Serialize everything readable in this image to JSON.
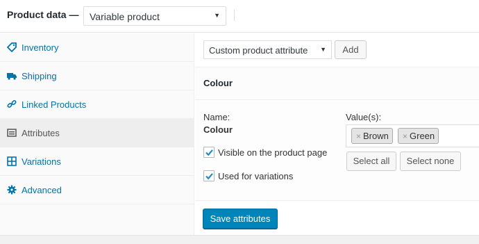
{
  "header": {
    "title": "Product data —",
    "product_type": "Variable product"
  },
  "sidebar": {
    "items": [
      {
        "label": "Inventory",
        "icon": "tag-icon"
      },
      {
        "label": "Shipping",
        "icon": "truck-icon"
      },
      {
        "label": "Linked Products",
        "icon": "link-icon"
      },
      {
        "label": "Attributes",
        "icon": "list-icon",
        "active": true
      },
      {
        "label": "Variations",
        "icon": "grid-icon"
      },
      {
        "label": "Advanced",
        "icon": "gear-icon"
      }
    ]
  },
  "toolbar": {
    "attribute_select": "Custom product attribute",
    "add_label": "Add"
  },
  "attribute": {
    "heading": "Colour",
    "name_label": "Name:",
    "name_value": "Colour",
    "visible_label": "Visible on the product page",
    "visible_checked": true,
    "variations_label": "Used for variations",
    "variations_checked": true,
    "values_label": "Value(s):",
    "values": [
      "Brown",
      "Green"
    ],
    "select_all_label": "Select all",
    "select_none_label": "Select none"
  },
  "footer": {
    "save_label": "Save attributes"
  },
  "colors": {
    "link": "#0073aa",
    "primary_button": "#0085ba",
    "active_tab_bg": "#eeeeee"
  }
}
